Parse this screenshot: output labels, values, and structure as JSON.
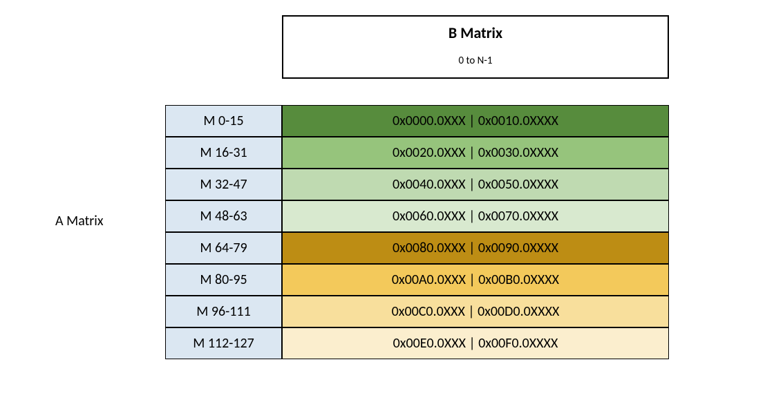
{
  "b_matrix": {
    "title": "B Matrix",
    "range": "0 to N-1"
  },
  "a_matrix_label": "A Matrix",
  "rows": [
    {
      "m": "M 0-15",
      "addr": "0x0000.0XXX | 0x0010.0XXXX",
      "color": "#578c3d"
    },
    {
      "m": "M 16-31",
      "addr": "0x0020.0XXX | 0x0030.0XXXX",
      "color": "#96c47c"
    },
    {
      "m": "M 32-47",
      "addr": "0x0040.0XXX | 0x0050.0XXXX",
      "color": "#bfdab1"
    },
    {
      "m": "M 48-63",
      "addr": "0x0060.0XXX | 0x0070.0XXXX",
      "color": "#d8e9cf"
    },
    {
      "m": "M 64-79",
      "addr": "0x0080.0XXX | 0x0090.0XXXX",
      "color": "#bd8d14"
    },
    {
      "m": "M 80-95",
      "addr": "0x00A0.0XXX | 0x00B0.0XXXX",
      "color": "#f3c95b"
    },
    {
      "m": "M 96-111",
      "addr": "0x00C0.0XXX | 0x00D0.0XXXX",
      "color": "#f8df9c"
    },
    {
      "m": "M 112-127",
      "addr": "0x00E0.0XXX | 0x00F0.0XXXX",
      "color": "#fbeece"
    }
  ]
}
